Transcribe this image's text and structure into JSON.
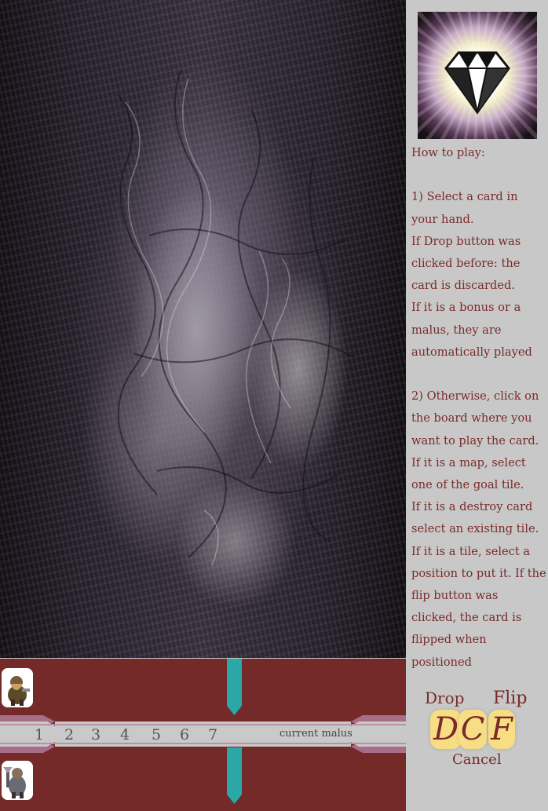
{
  "help": {
    "title": "How to play:",
    "lines": [
      "1) Select a card in your hand.",
      "If Drop button was clicked before: the card is discarded.",
      "If it is a bonus or a malus, they are automatically played",
      "2) Otherwise, click on the board where you want to play the card.",
      "If it is a map, select one of the goal tile.",
      "If it is a destroy card select an existing tile.",
      "If it is a tile, select a position to put it. If the flip button was clicked, the card is flipped when positioned"
    ]
  },
  "controls": {
    "drop_label": "Drop",
    "flip_label": "Flip",
    "cancel_label": "Cancel",
    "drop_glyph": "D",
    "cancel_glyph": "C",
    "flip_glyph": "F"
  },
  "track": {
    "numbers": [
      "1",
      "2",
      "3",
      "4",
      "5",
      "6",
      "7"
    ],
    "malus_label": "current malus"
  },
  "colors": {
    "bar": "#752a2a",
    "text": "#7a2a2a",
    "button": "#f7dd84",
    "marker": "#2aa8a8",
    "panel": "#c8c8c8"
  },
  "icons": {
    "logo": "diamond-icon",
    "player1": "dwarf-avatar",
    "player2": "warrior-avatar"
  }
}
